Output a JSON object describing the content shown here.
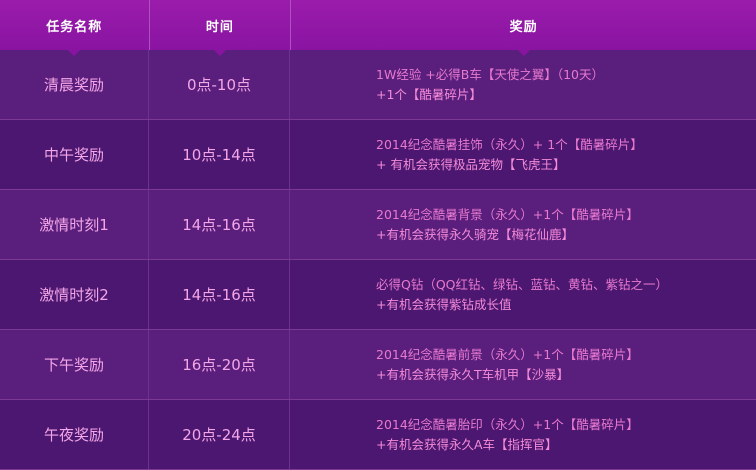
{
  "header": {
    "col_task": "任务名称",
    "col_time": "时间",
    "col_reward": "奖励"
  },
  "rows": [
    {
      "name": "清晨奖励",
      "time": "0点-10点",
      "reward_line1": "1W经验 +必得B车【天使之翼】（10天）",
      "reward_line2": "+1个【酷暑碎片】"
    },
    {
      "name": "中午奖励",
      "time": "10点-14点",
      "reward_line1": "2014纪念酷暑挂饰（永久）+ 1个【酷暑碎片】",
      "reward_line2": "+ 有机会获得极品宠物【飞虎王】"
    },
    {
      "name": "激情时刻1",
      "time": "14点-16点",
      "reward_line1": "2014纪念酷暑背景（永久）+1个【酷暑碎片】",
      "reward_line2": "+有机会获得永久骑宠【梅花仙鹿】"
    },
    {
      "name": "激情时刻2",
      "time": "14点-16点",
      "reward_line1": "必得Q钻（QQ红钻、绿钻、蓝钻、黄钻、紫钻之一）",
      "reward_line2": "+有机会获得紫钻成长值"
    },
    {
      "name": "下午奖励",
      "time": "16点-20点",
      "reward_line1": "2014纪念酷暑前景（永久）+1个【酷暑碎片】",
      "reward_line2": "+有机会获得永久T车机甲【沙暴】"
    },
    {
      "name": "午夜奖励",
      "time": "20点-24点",
      "reward_line1": "2014纪念酷暑胎印（永久）+1个【酷暑碎片】",
      "reward_line2": "+有机会获得永久A车【指挥官】"
    }
  ]
}
